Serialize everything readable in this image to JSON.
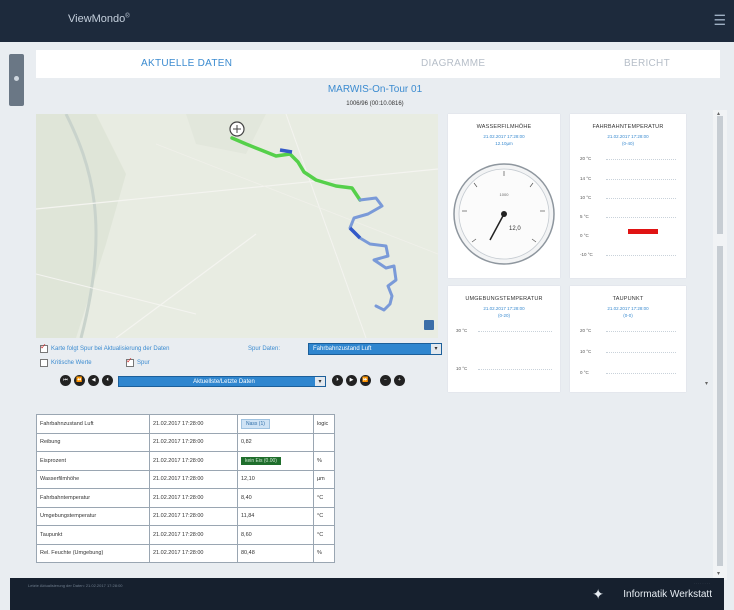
{
  "app": {
    "logo": "ViewMondo",
    "logo_sup": "®"
  },
  "tabs": [
    {
      "label": "AKTUELLE DATEN",
      "active": true
    },
    {
      "label": "DIAGRAMME",
      "active": false
    },
    {
      "label": "BERICHT",
      "active": false
    }
  ],
  "header": {
    "title": "MARWIS-On-Tour 01",
    "subtitle": "1006/96 (00:10.0816)"
  },
  "controls": {
    "follow_label": "Karte folgt Spur bei Aktualisierung der Daten",
    "track_color_label": "Spur Daten:",
    "track_select": "Fahrbahnzustand Luft",
    "critical_label": "Kritische Werte",
    "track_label": "Spur",
    "data_select": "Aktuellste/Letzte Daten",
    "follow_checked": true,
    "critical_checked": false,
    "track_checked": true
  },
  "panels": {
    "water": {
      "title": "WASSERFILMHÖHE",
      "time": "21.02.2017 17:28:00",
      "unit": "12.10µm",
      "gauge_value": "12,0"
    },
    "road_temp": {
      "title": "FAHRBAHNTEMPERATUR",
      "time": "21.02.2017 17:28:00",
      "unit": "(0-40)",
      "labels": [
        "20 °C",
        "14 °C",
        "10 °C",
        "5 °C",
        "0 °C",
        "-10 °C"
      ]
    },
    "ambient": {
      "title": "UMGEBUNGSTEMPERATUR",
      "time": "21.02.2017 17:28:00",
      "unit": "(0-20)",
      "labels": [
        "30 °C",
        "10 °C"
      ]
    },
    "dew": {
      "title": "TAUPUNKT",
      "time": "21.02.2017 17:28:00",
      "unit": "(0-0)",
      "labels": [
        "20 °C",
        "10 °C",
        "0 °C"
      ]
    }
  },
  "table": [
    {
      "name": "Fahrbahnzustand Luft",
      "time": "21.02.2017 17:28:00",
      "value": "Nass (1)",
      "unit": "logic",
      "badge": "blue"
    },
    {
      "name": "Reibung",
      "time": "21.02.2017 17:28:00",
      "value": "0,82",
      "unit": "",
      "badge": ""
    },
    {
      "name": "Eisprozent",
      "time": "21.02.2017 17:28:00",
      "value": "kein Eis (0.00)",
      "unit": "%",
      "badge": "green"
    },
    {
      "name": "Wasserfilmhöhe",
      "time": "21.02.2017 17:28:00",
      "value": "12,10",
      "unit": "µm",
      "badge": ""
    },
    {
      "name": "Fahrbahntemperatur",
      "time": "21.02.2017 17:28:00",
      "value": "8,40",
      "unit": "°C",
      "badge": ""
    },
    {
      "name": "Umgebungstemperatur",
      "time": "21.02.2017 17:28:00",
      "value": "11,84",
      "unit": "°C",
      "badge": ""
    },
    {
      "name": "Taupunkt",
      "time": "21.02.2017 17:28:00",
      "value": "8,60",
      "unit": "°C",
      "badge": ""
    },
    {
      "name": "Rel. Feuchte (Umgebung)",
      "time": "21.02.2017 17:28:00",
      "value": "80,48",
      "unit": "%",
      "badge": ""
    }
  ],
  "footer": {
    "left": "Letzte Aktualisierung der Daten: 21.02.2017 17:28:00",
    "brand": "Informatik Werkstatt"
  }
}
